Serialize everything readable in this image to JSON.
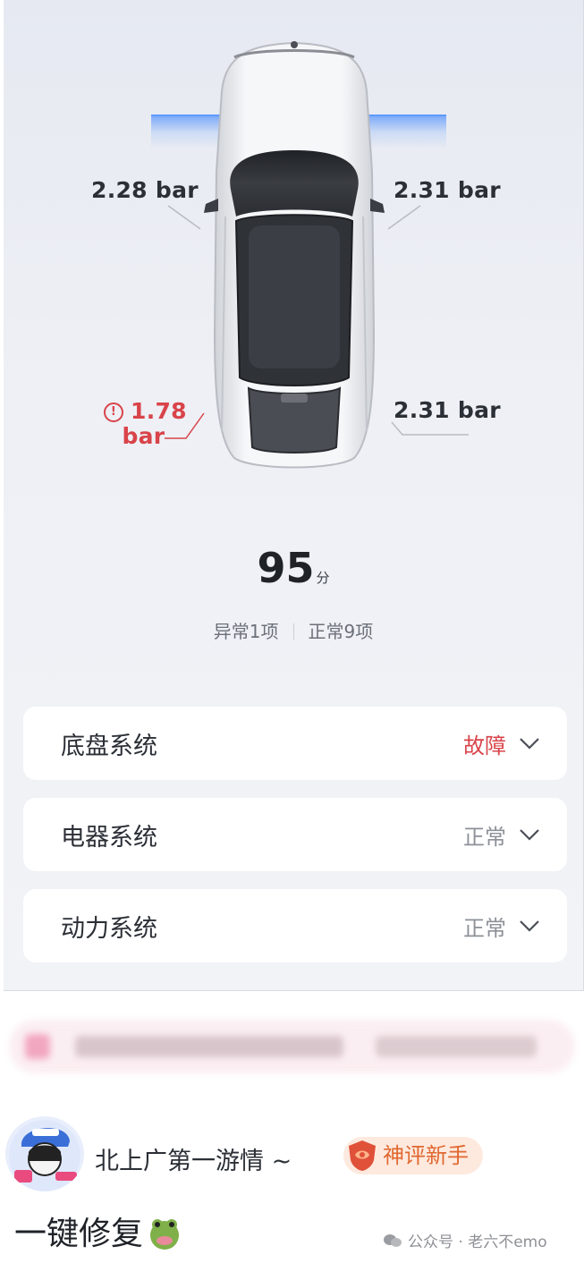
{
  "tires": {
    "front_left": "2.28 bar",
    "front_right": "2.31 bar",
    "rear_left_value": "1.78",
    "rear_left_unit": "bar",
    "rear_right": "2.31 bar",
    "warn_symbol": "!"
  },
  "score": {
    "value": "95",
    "unit": "分",
    "abnormal": "异常1项",
    "normal": "正常9项"
  },
  "systems": [
    {
      "label": "底盘系统",
      "status": "故障",
      "status_color": "#d8444a"
    },
    {
      "label": "电器系统",
      "status": "正常",
      "status_color": "#8c9097"
    },
    {
      "label": "动力系统",
      "status": "正常",
      "status_color": "#8c9097"
    }
  ],
  "comment": {
    "username": "北上广第一游情 ~",
    "badge": "神评新手",
    "text": "一键修复",
    "emoji_icon": "frog-face-icon"
  },
  "watermark": "公众号 · 老六不emo"
}
